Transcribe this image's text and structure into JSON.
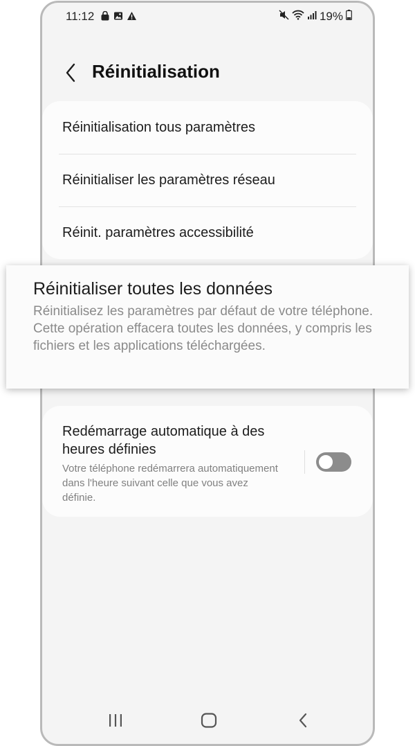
{
  "status_bar": {
    "time": "11:12",
    "battery": "19%",
    "left_icons": [
      "bag-icon",
      "image-icon",
      "warning-icon"
    ],
    "right_icons": [
      "mute-icon",
      "wifi-icon",
      "signal-icon",
      "battery-icon"
    ]
  },
  "header": {
    "title": "Réinitialisation"
  },
  "reset_list": {
    "items": [
      {
        "label": "Réinitialisation tous paramètres"
      },
      {
        "label": "Réinitialiser les paramètres réseau"
      },
      {
        "label": "Réinit. paramètres accessibilité"
      }
    ]
  },
  "factory_reset": {
    "title": "Réinitialiser toutes les données",
    "description": "Réinitialisez les paramètres par défaut de votre téléphone. Cette opération effacera toutes les données, y compris les fichiers et les applications téléchargées."
  },
  "auto_restart": {
    "title": "Redémarrage automatique à des heures définies",
    "description": "Votre téléphone redémarrera automatiquement dans l'heure suivant celle que vous avez définie.",
    "enabled": false
  },
  "nav_bar": {
    "buttons": [
      "recents-icon",
      "home-icon",
      "back-icon"
    ]
  },
  "colors": {
    "background": "#f4f4f4",
    "card": "#fcfcfc",
    "secondary_text": "#808080",
    "toggle_off": "#8c8c8c"
  }
}
